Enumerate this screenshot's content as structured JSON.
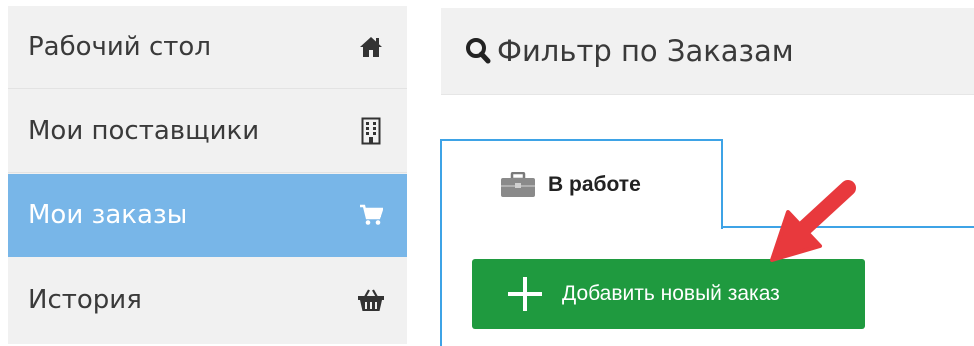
{
  "sidebar": {
    "items": [
      {
        "label": "Рабочий стол",
        "icon": "home-icon",
        "active": false
      },
      {
        "label": "Мои поставщики",
        "icon": "building-icon",
        "active": false
      },
      {
        "label": "Мои заказы",
        "icon": "cart-icon",
        "active": true
      },
      {
        "label": "История",
        "icon": "basket-icon",
        "active": false
      }
    ]
  },
  "filter": {
    "label": "Фильтр по Заказам",
    "icon": "search-icon"
  },
  "tabs": [
    {
      "label": "В работе",
      "icon": "briefcase-icon",
      "active": true
    }
  ],
  "actions": {
    "add_order_label": "Добавить новый заказ"
  },
  "colors": {
    "sidebar_bg": "#f1f1f1",
    "active_item": "#78b6e8",
    "tab_border": "#3ea3e6",
    "add_button": "#1f9a3f",
    "annotation_arrow": "#e8393d"
  }
}
